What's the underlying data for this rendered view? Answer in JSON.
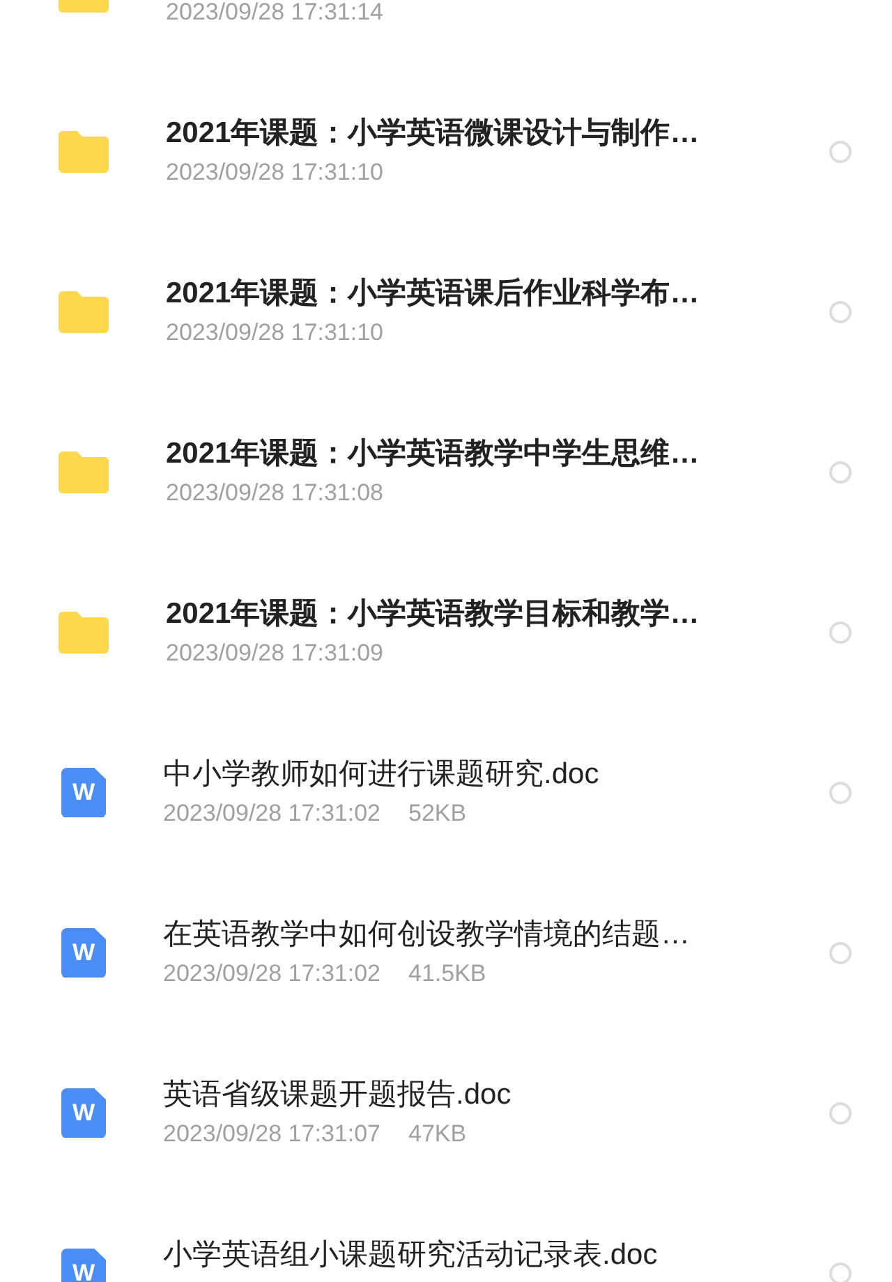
{
  "files": [
    {
      "kind": "folder",
      "date": "2023/09/28 17:31:14"
    },
    {
      "kind": "folder",
      "name": "2021年课题：小学英语微课设计与制作…",
      "date": "2023/09/28 17:31:10",
      "selected": false
    },
    {
      "kind": "folder",
      "name": "2021年课题：小学英语课后作业科学布…",
      "date": "2023/09/28 17:31:10",
      "selected": false
    },
    {
      "kind": "folder",
      "name": "2021年课题：小学英语教学中学生思维…",
      "date": "2023/09/28 17:31:08",
      "selected": false
    },
    {
      "kind": "folder",
      "name": "2021年课题：小学英语教学目标和教学…",
      "date": "2023/09/28 17:31:09",
      "selected": false
    },
    {
      "kind": "doc",
      "badge": "W",
      "name": "中小学教师如何进行课题研究.doc",
      "date": "2023/09/28 17:31:02",
      "size": "52KB",
      "selected": false
    },
    {
      "kind": "doc",
      "badge": "W",
      "name": "在英语教学中如何创设教学情境的结题…",
      "date": "2023/09/28 17:31:02",
      "size": "41.5KB",
      "selected": false
    },
    {
      "kind": "doc",
      "badge": "W",
      "name": "英语省级课题开题报告.doc",
      "date": "2023/09/28 17:31:07",
      "size": "47KB",
      "selected": false
    },
    {
      "kind": "doc",
      "badge": "W",
      "name": "小学英语组小课题研究活动记录表.doc",
      "selected": false
    }
  ]
}
